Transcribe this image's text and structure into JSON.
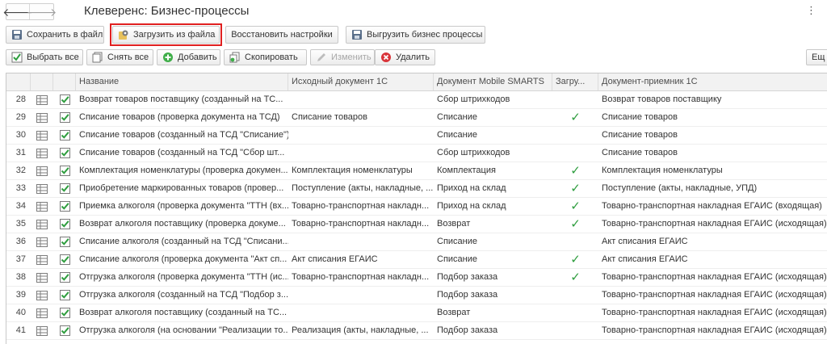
{
  "window": {
    "title": "Клеверенс: Бизнес-процессы",
    "more_glyph": "⋮"
  },
  "nav": {
    "back_glyph": "🡐",
    "forward_glyph": "🡒"
  },
  "toolbar_main": {
    "save_to_file": "Сохранить в файл",
    "load_from_file": "Загрузить из файла",
    "restore_settings": "Восстановить настройки",
    "export_processes": "Выгрузить бизнес процессы"
  },
  "toolbar_edit": {
    "select_all": "Выбрать все",
    "deselect_all": "Снять все",
    "add": "Добавить",
    "copy": "Скопировать",
    "edit": "Изменить",
    "delete": "Удалить",
    "more": "Ещ"
  },
  "colors": {
    "highlight": "#e02020",
    "tick": "#2f9e3f",
    "checkbox": "#2f9e3f"
  },
  "table": {
    "columns": [
      "Название",
      "Исходный документ 1С",
      "Документ Mobile SMARTS",
      "Загру...",
      "Документ-приемник 1С"
    ],
    "rows": [
      {
        "num": "28",
        "name": "Возврат товаров поставщику (созданный на ТС...",
        "source": "",
        "mobile": "Сбор штрихкодов",
        "loaded": "",
        "target": "Возврат товаров поставщику"
      },
      {
        "num": "29",
        "name": "Списание товаров (проверка документа на ТСД)",
        "source": "Списание товаров",
        "mobile": "Списание",
        "loaded": "✓",
        "target": "Списание товаров"
      },
      {
        "num": "30",
        "name": "Списание товаров (созданный на ТСД \"Списание\")",
        "source": "",
        "mobile": "Списание",
        "loaded": "",
        "target": "Списание товаров"
      },
      {
        "num": "31",
        "name": "Списание товаров (созданный на ТСД \"Сбор шт...",
        "source": "",
        "mobile": "Сбор штрихкодов",
        "loaded": "",
        "target": "Списание товаров"
      },
      {
        "num": "32",
        "name": "Комплектация номенклатуры (проверка докумен...",
        "source": "Комплектация номенклатуры",
        "mobile": "Комплектация",
        "loaded": "✓",
        "target": "Комплектация номенклатуры"
      },
      {
        "num": "33",
        "name": "Приобретение маркированных товаров (провер...",
        "source": "Поступление (акты, накладные, ...",
        "mobile": "Приход на склад",
        "loaded": "✓",
        "target": "Поступление (акты, накладные, УПД)"
      },
      {
        "num": "34",
        "name": "Приемка алкоголя (проверка документа \"ТТН (вх...",
        "source": "Товарно-транспортная накладн...",
        "mobile": "Приход на склад",
        "loaded": "✓",
        "target": "Товарно-транспортная накладная ЕГАИС (входящая)"
      },
      {
        "num": "35",
        "name": "Возврат алкоголя поставщику (проверка докуме...",
        "source": "Товарно-транспортная накладн...",
        "mobile": "Возврат",
        "loaded": "✓",
        "target": "Товарно-транспортная накладная ЕГАИС (исходящая)"
      },
      {
        "num": "36",
        "name": "Списание алкоголя (созданный на ТСД \"Списани...",
        "source": "",
        "mobile": "Списание",
        "loaded": "",
        "target": "Акт списания ЕГАИС"
      },
      {
        "num": "37",
        "name": "Списание алкоголя (проверка документа \"Акт сп...",
        "source": "Акт списания ЕГАИС",
        "mobile": "Списание",
        "loaded": "✓",
        "target": "Акт списания ЕГАИС"
      },
      {
        "num": "38",
        "name": "Отгрузка алкоголя (проверка документа \"ТТН (ис...",
        "source": "Товарно-транспортная накладн...",
        "mobile": "Подбор заказа",
        "loaded": "✓",
        "target": "Товарно-транспортная накладная ЕГАИС (исходящая)"
      },
      {
        "num": "39",
        "name": "Отгрузка алкоголя (созданный на ТСД \"Подбор з...",
        "source": "",
        "mobile": "Подбор заказа",
        "loaded": "",
        "target": "Товарно-транспортная накладная ЕГАИС (исходящая)"
      },
      {
        "num": "40",
        "name": "Возврат алкоголя поставщику (созданный на ТС...",
        "source": "",
        "mobile": "Возврат",
        "loaded": "",
        "target": "Товарно-транспортная накладная ЕГАИС (исходящая)"
      },
      {
        "num": "41",
        "name": "Отгрузка алкоголя (на основании \"Реализации то...",
        "source": "Реализация (акты, накладные, ...",
        "mobile": "Подбор заказа",
        "loaded": "",
        "target": "Товарно-транспортная накладная ЕГАИС (исходящая)"
      }
    ]
  }
}
